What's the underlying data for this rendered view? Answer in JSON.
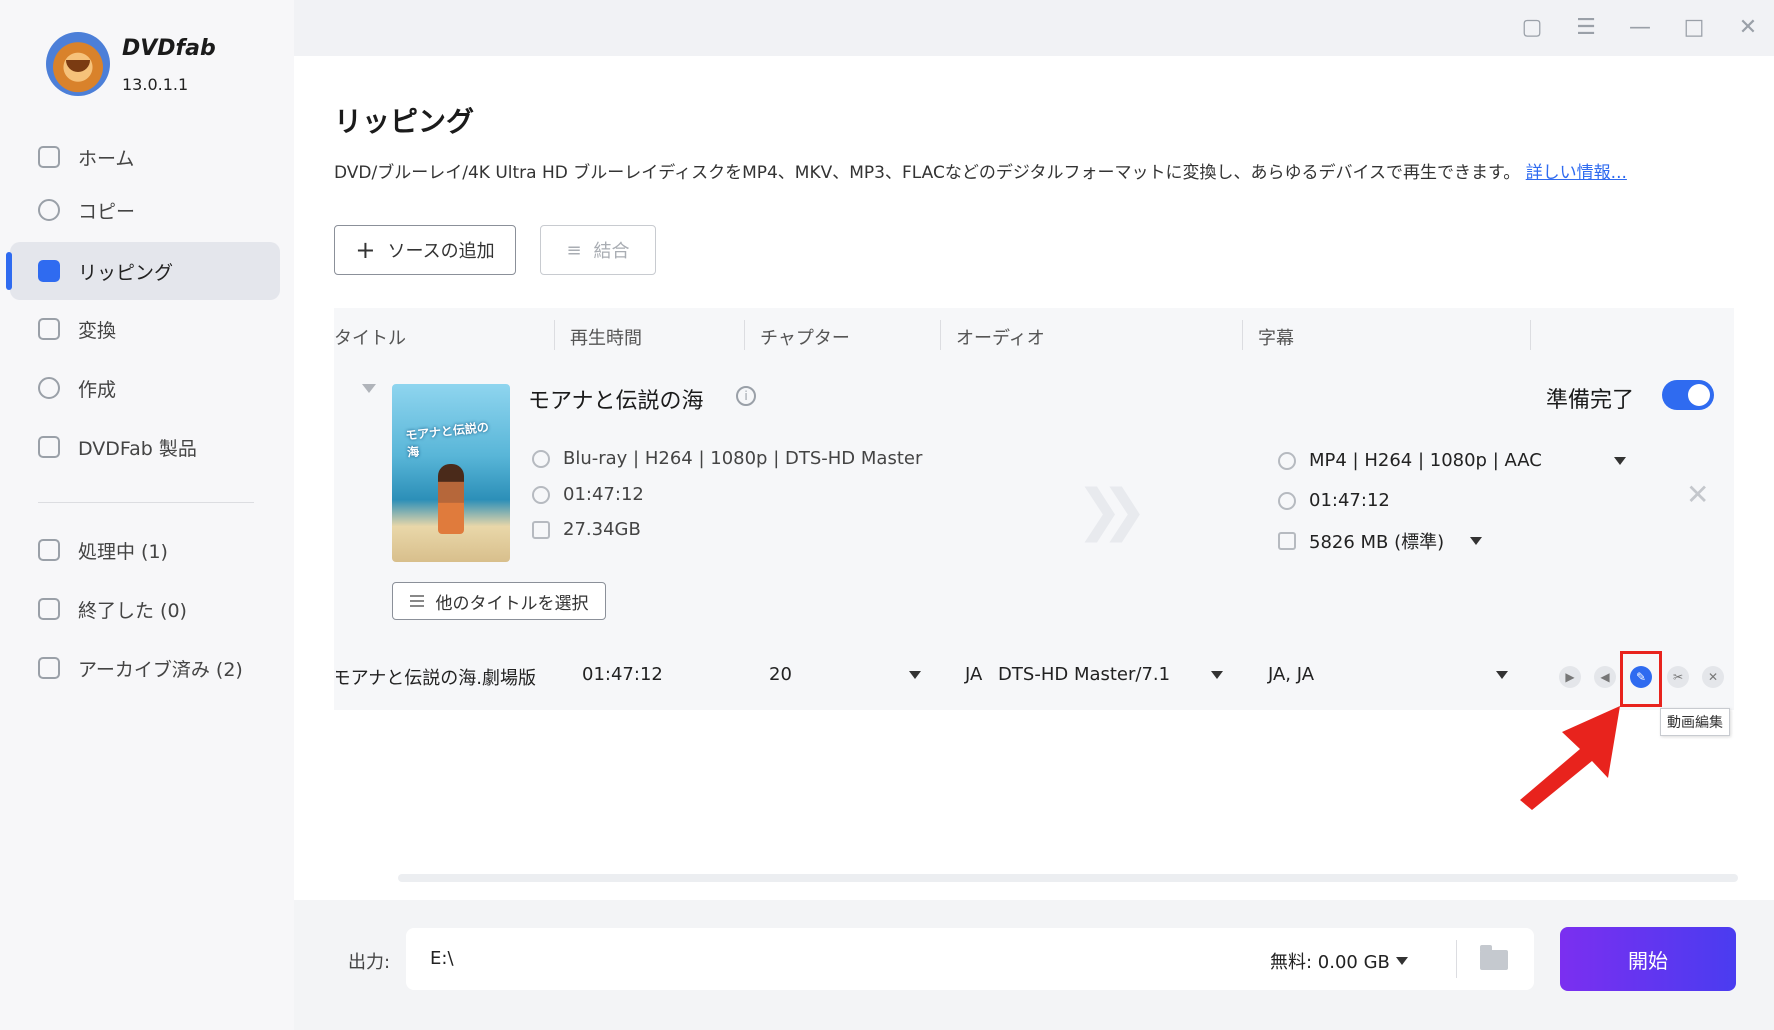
{
  "app": {
    "brand": "DVDfab",
    "version": "13.0.1.1"
  },
  "sidebar": {
    "items": [
      {
        "label": "ホーム",
        "icon": "home-icon"
      },
      {
        "label": "コピー",
        "icon": "copy-disc-icon"
      },
      {
        "label": "リッピング",
        "icon": "ripper-icon",
        "active": true
      },
      {
        "label": "変換",
        "icon": "film-icon"
      },
      {
        "label": "作成",
        "icon": "creator-disc-icon"
      },
      {
        "label": "DVDFab 製品",
        "icon": "products-icon"
      }
    ],
    "queue": [
      {
        "label": "処理中 (1)",
        "icon": "processing-icon"
      },
      {
        "label": "終了した (0)",
        "icon": "finished-icon"
      },
      {
        "label": "アーカイブ済み (2)",
        "icon": "archive-icon"
      }
    ]
  },
  "header": {
    "title": "リッピング",
    "description": "DVD/ブルーレイ/4K Ultra HD ブルーレイディスクをMP4、MKV、MP3、FLACなどのデジタルフォーマットに変換し、あらゆるデバイスで再生できます。",
    "more_link": "詳しい情報..."
  },
  "toolbar": {
    "add_source": "ソースの追加",
    "merge": "結合"
  },
  "table": {
    "columns": [
      "タイトル",
      "再生時間",
      "チャプター",
      "オーディオ",
      "字幕"
    ]
  },
  "item": {
    "title": "モアナと伝説の海",
    "poster_text": "モアナと伝説の海",
    "source_format": "Blu-ray | H264 | 1080p | DTS-HD Master",
    "source_duration": "01:47:12",
    "source_size": "27.34GB",
    "ready_label": "準備完了",
    "ready": true,
    "output_format": "MP4 | H264 | 1080p | AAC",
    "output_duration": "01:47:12",
    "output_size": "5826 MB (標準)",
    "select_other": "他のタイトルを選択"
  },
  "title_row": {
    "name": "モアナと伝説の海.劇場版",
    "duration": "01:47:12",
    "chapters": "20",
    "audio_lang": "JA",
    "audio": "DTS-HD Master/7.1",
    "subtitles": "JA, JA",
    "tooltip": "動画編集"
  },
  "output": {
    "label": "出力:",
    "path": "E:\\",
    "free_space": "無料: 0.00 GB",
    "start": "開始"
  },
  "colors": {
    "accent": "#2f6bf0",
    "start_from": "#7b2ff0",
    "start_to": "#4a3cf0",
    "highlight": "#e8231d"
  }
}
